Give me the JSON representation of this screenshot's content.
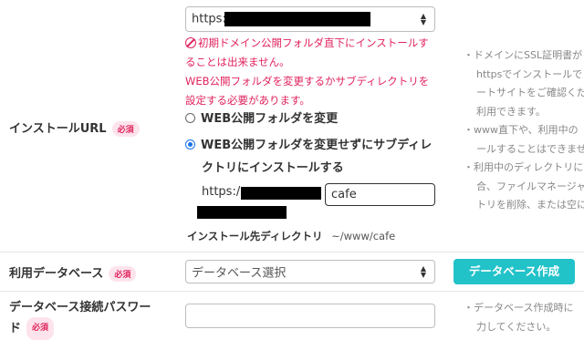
{
  "install_url": {
    "label": "インストールURL",
    "required_badge": "必須",
    "scheme_select": {
      "value": "https:"
    },
    "error_line1": "初期ドメイン公開フォルダ直下にインストールす",
    "error_line2": "ることは出来ません。",
    "error_line3": "WEB公開フォルダを変更するかサブディレクトリを",
    "error_line4": "設定する必要があります。",
    "option_change_folder": "WEB公開フォルダを変更",
    "option_subdir_line1": "WEB公開フォルダを変更せずにサブディレ",
    "option_subdir_line2": "クトリにインストールする",
    "subdir_prefix": "https:/",
    "subdir_value": "cafe",
    "install_dir_label": "インストール先ディレクトリ",
    "install_dir_value": "~/www/cafe",
    "hints": [
      "・ドメインにSSL証明書が",
      "httpsでインストールで",
      "ートサイトをご確認くだ",
      "利用できます。",
      "・www直下や、利用中の",
      "ールすることはできませ",
      "・利用中のディレクトリに",
      "合、ファイルマネージャ",
      "トリを削除、または空に"
    ]
  },
  "database": {
    "label": "利用データベース",
    "required_badge": "必須",
    "select_value": "データベース選択",
    "create_button": "データベース作成"
  },
  "db_password": {
    "label_line1": "データベース接続パスワー",
    "label_line2": "ド",
    "required_badge": "必須",
    "value": "",
    "hints": [
      "・データベース作成時に",
      "力してください。"
    ]
  },
  "colors": {
    "accent": "#22c2c9",
    "error": "#e0245e",
    "radio_selected": "#1a73e8"
  }
}
